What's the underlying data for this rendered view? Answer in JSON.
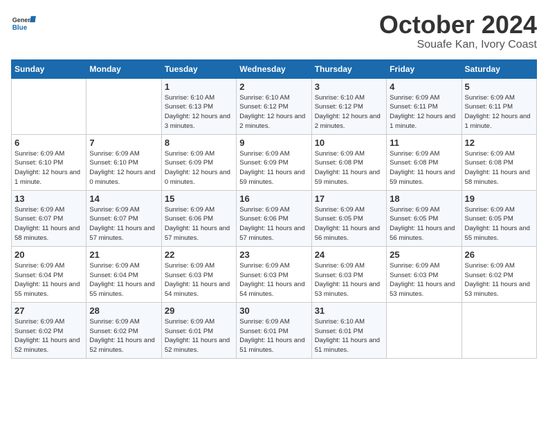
{
  "header": {
    "logo_general": "General",
    "logo_blue": "Blue",
    "month": "October 2024",
    "location": "Souafe Kan, Ivory Coast"
  },
  "weekdays": [
    "Sunday",
    "Monday",
    "Tuesday",
    "Wednesday",
    "Thursday",
    "Friday",
    "Saturday"
  ],
  "weeks": [
    [
      {
        "day": "",
        "text": ""
      },
      {
        "day": "",
        "text": ""
      },
      {
        "day": "1",
        "text": "Sunrise: 6:10 AM\nSunset: 6:13 PM\nDaylight: 12 hours and 3 minutes."
      },
      {
        "day": "2",
        "text": "Sunrise: 6:10 AM\nSunset: 6:12 PM\nDaylight: 12 hours and 2 minutes."
      },
      {
        "day": "3",
        "text": "Sunrise: 6:10 AM\nSunset: 6:12 PM\nDaylight: 12 hours and 2 minutes."
      },
      {
        "day": "4",
        "text": "Sunrise: 6:09 AM\nSunset: 6:11 PM\nDaylight: 12 hours and 1 minute."
      },
      {
        "day": "5",
        "text": "Sunrise: 6:09 AM\nSunset: 6:11 PM\nDaylight: 12 hours and 1 minute."
      }
    ],
    [
      {
        "day": "6",
        "text": "Sunrise: 6:09 AM\nSunset: 6:10 PM\nDaylight: 12 hours and 1 minute."
      },
      {
        "day": "7",
        "text": "Sunrise: 6:09 AM\nSunset: 6:10 PM\nDaylight: 12 hours and 0 minutes."
      },
      {
        "day": "8",
        "text": "Sunrise: 6:09 AM\nSunset: 6:09 PM\nDaylight: 12 hours and 0 minutes."
      },
      {
        "day": "9",
        "text": "Sunrise: 6:09 AM\nSunset: 6:09 PM\nDaylight: 11 hours and 59 minutes."
      },
      {
        "day": "10",
        "text": "Sunrise: 6:09 AM\nSunset: 6:08 PM\nDaylight: 11 hours and 59 minutes."
      },
      {
        "day": "11",
        "text": "Sunrise: 6:09 AM\nSunset: 6:08 PM\nDaylight: 11 hours and 59 minutes."
      },
      {
        "day": "12",
        "text": "Sunrise: 6:09 AM\nSunset: 6:08 PM\nDaylight: 11 hours and 58 minutes."
      }
    ],
    [
      {
        "day": "13",
        "text": "Sunrise: 6:09 AM\nSunset: 6:07 PM\nDaylight: 11 hours and 58 minutes."
      },
      {
        "day": "14",
        "text": "Sunrise: 6:09 AM\nSunset: 6:07 PM\nDaylight: 11 hours and 57 minutes."
      },
      {
        "day": "15",
        "text": "Sunrise: 6:09 AM\nSunset: 6:06 PM\nDaylight: 11 hours and 57 minutes."
      },
      {
        "day": "16",
        "text": "Sunrise: 6:09 AM\nSunset: 6:06 PM\nDaylight: 11 hours and 57 minutes."
      },
      {
        "day": "17",
        "text": "Sunrise: 6:09 AM\nSunset: 6:05 PM\nDaylight: 11 hours and 56 minutes."
      },
      {
        "day": "18",
        "text": "Sunrise: 6:09 AM\nSunset: 6:05 PM\nDaylight: 11 hours and 56 minutes."
      },
      {
        "day": "19",
        "text": "Sunrise: 6:09 AM\nSunset: 6:05 PM\nDaylight: 11 hours and 55 minutes."
      }
    ],
    [
      {
        "day": "20",
        "text": "Sunrise: 6:09 AM\nSunset: 6:04 PM\nDaylight: 11 hours and 55 minutes."
      },
      {
        "day": "21",
        "text": "Sunrise: 6:09 AM\nSunset: 6:04 PM\nDaylight: 11 hours and 55 minutes."
      },
      {
        "day": "22",
        "text": "Sunrise: 6:09 AM\nSunset: 6:03 PM\nDaylight: 11 hours and 54 minutes."
      },
      {
        "day": "23",
        "text": "Sunrise: 6:09 AM\nSunset: 6:03 PM\nDaylight: 11 hours and 54 minutes."
      },
      {
        "day": "24",
        "text": "Sunrise: 6:09 AM\nSunset: 6:03 PM\nDaylight: 11 hours and 53 minutes."
      },
      {
        "day": "25",
        "text": "Sunrise: 6:09 AM\nSunset: 6:03 PM\nDaylight: 11 hours and 53 minutes."
      },
      {
        "day": "26",
        "text": "Sunrise: 6:09 AM\nSunset: 6:02 PM\nDaylight: 11 hours and 53 minutes."
      }
    ],
    [
      {
        "day": "27",
        "text": "Sunrise: 6:09 AM\nSunset: 6:02 PM\nDaylight: 11 hours and 52 minutes."
      },
      {
        "day": "28",
        "text": "Sunrise: 6:09 AM\nSunset: 6:02 PM\nDaylight: 11 hours and 52 minutes."
      },
      {
        "day": "29",
        "text": "Sunrise: 6:09 AM\nSunset: 6:01 PM\nDaylight: 11 hours and 52 minutes."
      },
      {
        "day": "30",
        "text": "Sunrise: 6:09 AM\nSunset: 6:01 PM\nDaylight: 11 hours and 51 minutes."
      },
      {
        "day": "31",
        "text": "Sunrise: 6:10 AM\nSunset: 6:01 PM\nDaylight: 11 hours and 51 minutes."
      },
      {
        "day": "",
        "text": ""
      },
      {
        "day": "",
        "text": ""
      }
    ]
  ]
}
